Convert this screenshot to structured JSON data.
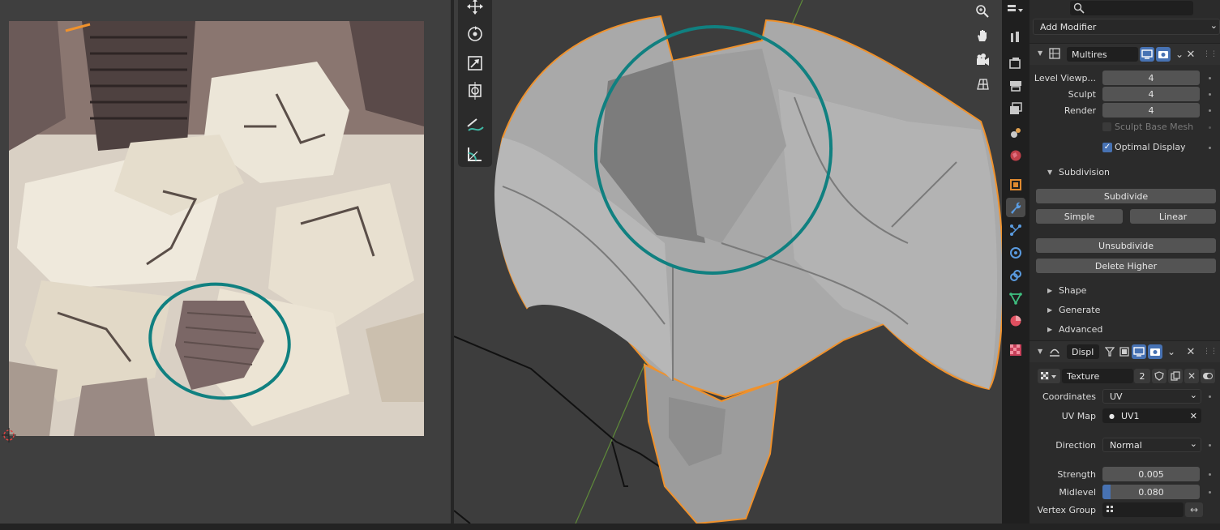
{
  "colors": {
    "accent_blue": "#4772b3",
    "annotation_teal": "#108080",
    "selection_outline": "#f0922c",
    "panel_bg": "#2b2b2b",
    "viewport_bg": "#3d3d3d"
  },
  "uv_editor": {
    "icons": [
      "uv-texture-image",
      "cursor-3d-icon"
    ]
  },
  "viewport": {
    "tools": [
      "move-icon",
      "rotate-icon",
      "scale-icon",
      "transform-icon",
      "annotate-icon",
      "measure-icon"
    ],
    "nav": [
      "zoom-icon",
      "hand-pan-icon",
      "camera-icon",
      "grid-icon"
    ]
  },
  "props": {
    "search_placeholder": "",
    "add_modifier": "Add Modifier",
    "multires": {
      "name": "Multires",
      "level_viewport_label": "Level Viewp...",
      "level_viewport": "4",
      "sculpt_label": "Sculpt",
      "sculpt": "4",
      "render_label": "Render",
      "render": "4",
      "sculpt_base_mesh": "Sculpt Base Mesh",
      "optimal_display": "Optimal Display",
      "subdivision_header": "Subdivision",
      "subdivide": "Subdivide",
      "simple": "Simple",
      "linear": "Linear",
      "unsubdivide": "Unsubdivide",
      "delete_higher": "Delete Higher",
      "shape": "Shape",
      "generate": "Generate",
      "advanced": "Advanced"
    },
    "displace": {
      "name": "Displ",
      "texture_label": "Texture",
      "texture_users": "2",
      "coordinates_label": "Coordinates",
      "coordinates": "UV",
      "uvmap_label": "UV Map",
      "uvmap": "UV1",
      "direction_label": "Direction",
      "direction": "Normal",
      "strength_label": "Strength",
      "strength": "0.005",
      "midlevel_label": "Midlevel",
      "midlevel": "0.080",
      "midlevel_fill": 0.08,
      "vertex_group_label": "Vertex Group"
    }
  }
}
